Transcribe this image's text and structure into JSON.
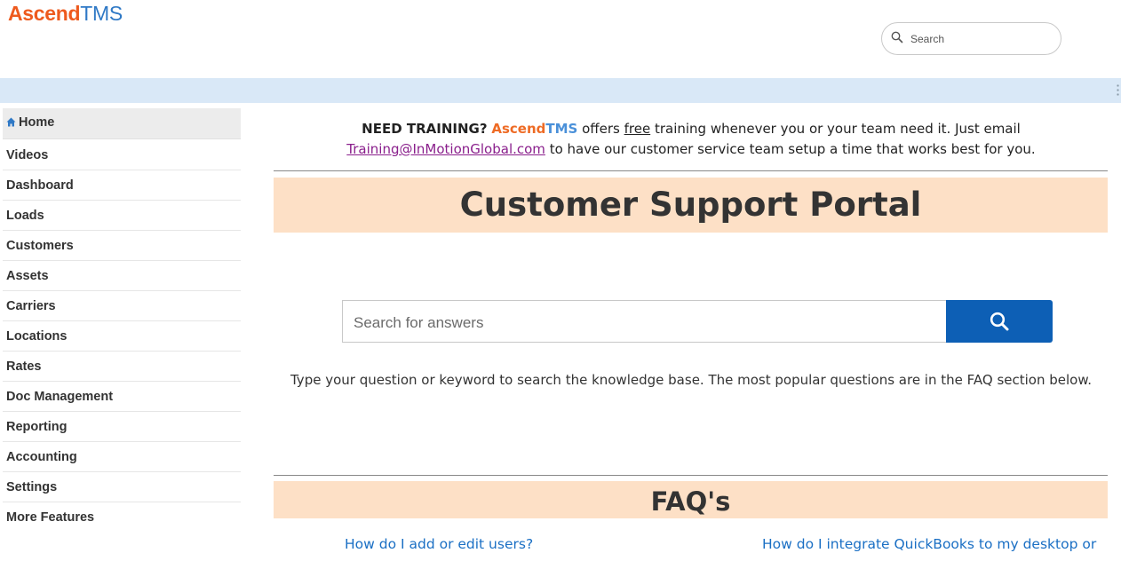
{
  "header": {
    "logo_part1": "Ascend",
    "logo_part2": "TMS",
    "search_placeholder": "Search"
  },
  "sidebar": {
    "items": [
      {
        "label": "Home"
      },
      {
        "label": "Videos"
      },
      {
        "label": "Dashboard"
      },
      {
        "label": "Loads"
      },
      {
        "label": "Customers"
      },
      {
        "label": "Assets"
      },
      {
        "label": "Carriers"
      },
      {
        "label": "Locations"
      },
      {
        "label": "Rates"
      },
      {
        "label": "Doc Management"
      },
      {
        "label": "Reporting"
      },
      {
        "label": "Accounting"
      },
      {
        "label": "Settings"
      },
      {
        "label": "More Features"
      }
    ]
  },
  "training": {
    "lead": "NEED TRAINING?",
    "brand_a": "Ascend",
    "brand_b": "TMS",
    "text1": " offers ",
    "free": "free",
    "text2": " training whenever you or your team need it. Just email",
    "email": "Training@InMotionGlobal.com",
    "text3": " to have our customer service team setup a time that works best for you."
  },
  "main": {
    "title": "Customer Support Portal",
    "search_placeholder": "Search for answers",
    "helper": "Type your question or keyword to search the knowledge base. The most popular questions are in the FAQ section below.",
    "faq_title": "FAQ's",
    "faq_links": [
      "How do I add or edit users?",
      "How do I integrate QuickBooks to my desktop or"
    ]
  },
  "colors": {
    "brand_orange": "#ee5a1e",
    "brand_blue": "#2f79c6",
    "banner_bg": "#fde0c6",
    "button_blue": "#0d5fb5",
    "link_blue": "#1a6fc4"
  }
}
